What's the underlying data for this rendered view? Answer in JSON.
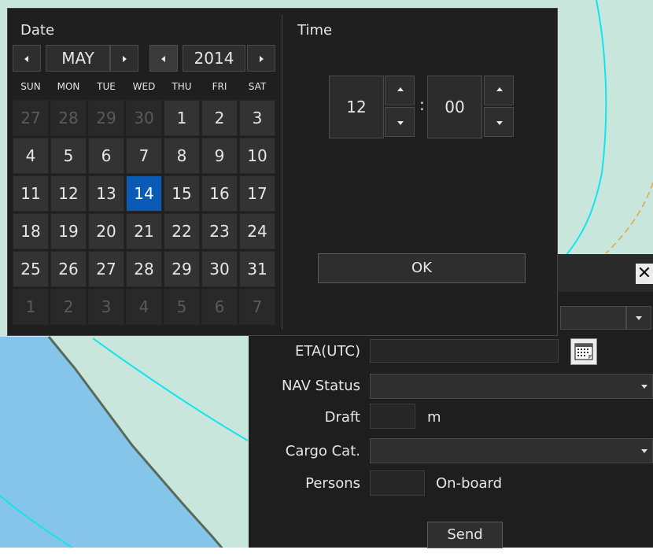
{
  "colors": {
    "sea_light": "#c9e6dc",
    "sea_deep": "#85c5ea",
    "contour_cyan": "#12e4ee",
    "coast_line": "#5a6a5a",
    "route_orange": "#e5a84a",
    "panel_bg": "#1f1f1f",
    "selected_day": "#0a5bb5"
  },
  "picker": {
    "date_title": "Date",
    "time_title": "Time",
    "month": "MAY",
    "year": "2014",
    "weekdays": [
      "SUN",
      "MON",
      "TUE",
      "WED",
      "THU",
      "FRI",
      "SAT"
    ],
    "weeks": [
      [
        "27",
        "28",
        "29",
        "30",
        "1",
        "2",
        "3"
      ],
      [
        "4",
        "5",
        "6",
        "7",
        "8",
        "9",
        "10"
      ],
      [
        "11",
        "12",
        "13",
        "14",
        "15",
        "16",
        "17"
      ],
      [
        "18",
        "19",
        "20",
        "21",
        "22",
        "23",
        "24"
      ],
      [
        "25",
        "26",
        "27",
        "28",
        "29",
        "30",
        "31"
      ],
      [
        "1",
        "2",
        "3",
        "4",
        "5",
        "6",
        "7"
      ]
    ],
    "selected_day": "14",
    "hour": "12",
    "minute": "00",
    "time_separator": ":",
    "ok_label": "OK"
  },
  "ais_form": {
    "close_icon": "close-icon",
    "eta_label": "ETA(UTC)",
    "eta_value": "",
    "calendar_icon": "calendar-icon",
    "nav_status_label": "NAV Status",
    "nav_status_value": "",
    "draft_label": "Draft",
    "draft_value": "",
    "draft_unit": "m",
    "cargo_label": "Cargo Cat.",
    "cargo_value": "",
    "persons_label": "Persons",
    "persons_value": "",
    "persons_unit": "On-board",
    "send_label": "Send"
  }
}
